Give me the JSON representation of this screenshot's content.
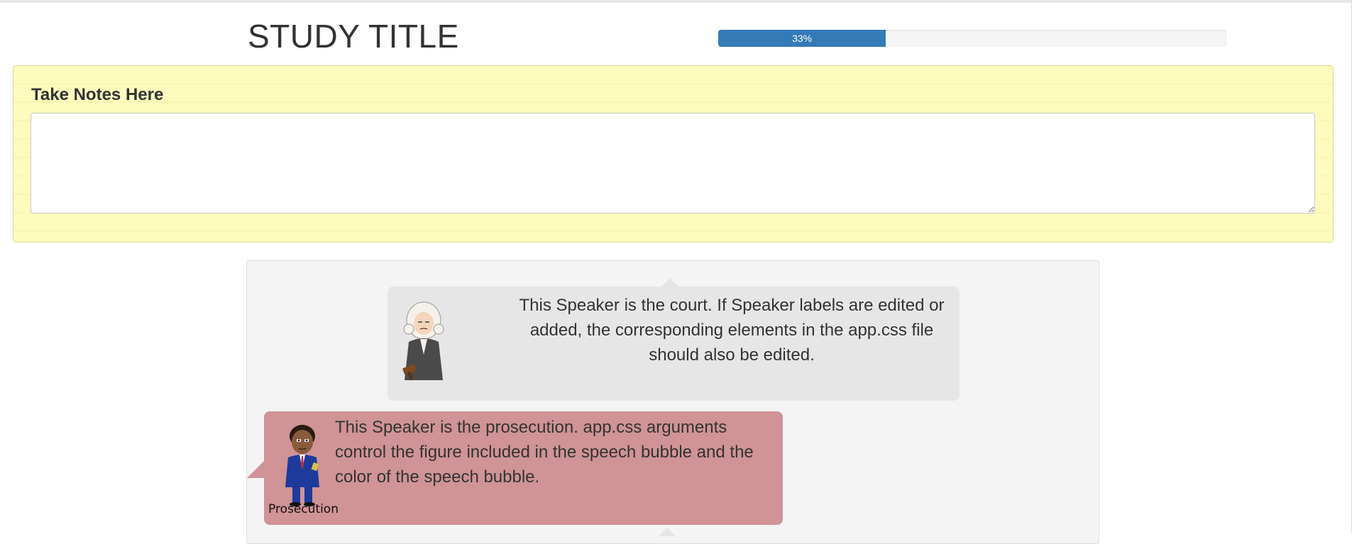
{
  "header": {
    "title": "STUDY TITLE",
    "progress": {
      "label": "33%",
      "value": 0.33
    }
  },
  "notes": {
    "label": "Take Notes Here",
    "value": "",
    "placeholder": ""
  },
  "transcript": {
    "bubbles": [
      {
        "speaker": "court",
        "avatar_icon": "judge-avatar-icon",
        "text": "This Speaker is the court. If Speaker labels are edited or added, the corresponding elements in the app.css file should also be edited.",
        "color": "#e6e6e6"
      },
      {
        "speaker": "prosecution",
        "avatar_icon": "prosecutor-avatar-icon",
        "caption": "Prosecution",
        "text": "This Speaker is the prosecution. app.css arguments control the figure included in the speech bubble and the color of the speech bubble.",
        "color": "#d09396"
      }
    ]
  },
  "colors": {
    "progress_bar": "#337ab7",
    "notes_panel": "#fdfbbd"
  }
}
